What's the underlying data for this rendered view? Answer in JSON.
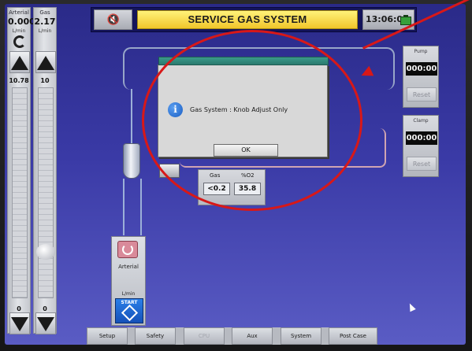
{
  "header": {
    "title": "SERVICE GAS SYSTEM",
    "clock": "13:06:08",
    "mute_icon": "mute-alarm-icon",
    "battery_icon": "battery-icon"
  },
  "left_columns": {
    "arterial": {
      "label": "Arterial",
      "value": "0.000",
      "unit": "L/min",
      "setpoint": "10.78",
      "bottom": "0"
    },
    "gas": {
      "label": "Gas",
      "value": "2.17",
      "unit": "L/min",
      "setpoint": "10",
      "bottom": "0"
    }
  },
  "right_panels": {
    "pump_timer": {
      "label": "Pump",
      "value": "000:00",
      "reset": "Reset"
    },
    "clamp_timer": {
      "label": "Clamp",
      "value": "000:00",
      "reset": "Reset"
    }
  },
  "dialog": {
    "message": "Gas System : Knob Adjust Only",
    "ok_label": "OK",
    "icon": "info-icon"
  },
  "gas_readout": {
    "gas_label": "Gas",
    "gas_value": "<0.2",
    "o2_label": "%O2",
    "o2_value": "35.8"
  },
  "arterial_module": {
    "label": "Arterial",
    "unit": "L/min",
    "start_label": "START"
  },
  "tabs": [
    {
      "label": "Setup",
      "enabled": true
    },
    {
      "label": "Safety",
      "enabled": true
    },
    {
      "label": "CPU",
      "enabled": false
    },
    {
      "label": "Aux",
      "enabled": true
    },
    {
      "label": "System",
      "enabled": true
    },
    {
      "label": "Post Case",
      "enabled": true
    }
  ],
  "colors": {
    "annotation": "#d81818",
    "title_background": "#f1c62a",
    "screen_background": "#3a3aa6"
  }
}
